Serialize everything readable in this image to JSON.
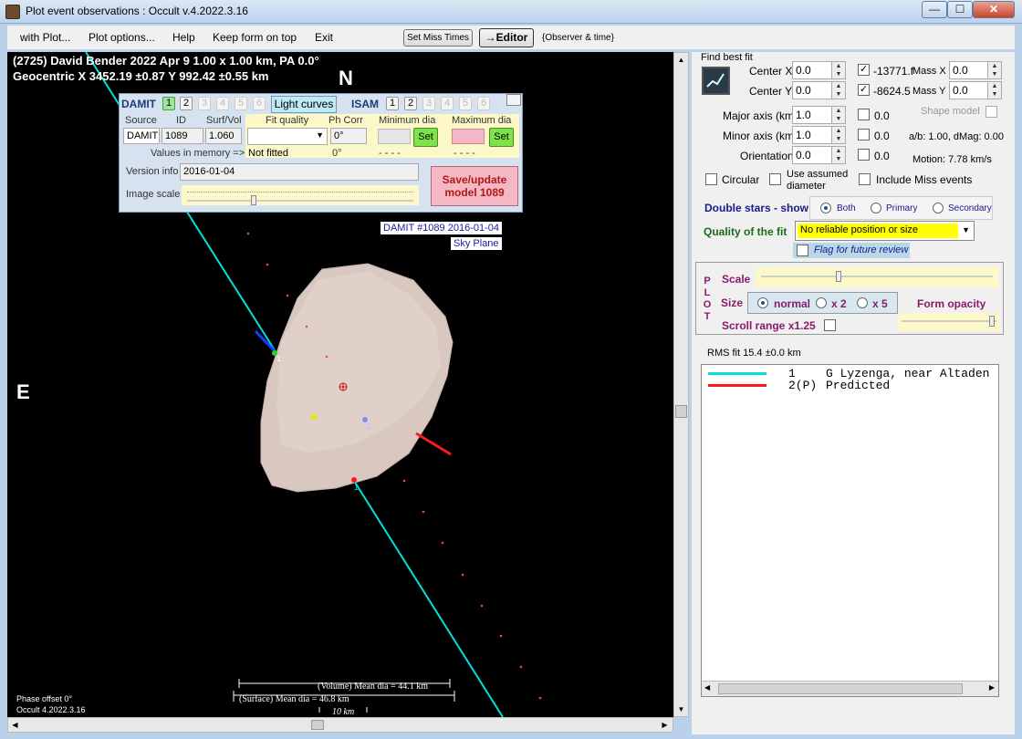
{
  "window": {
    "title": "Plot event observations : Occult v.4.2022.3.16",
    "minimize": "—",
    "maximize": "☐",
    "close": "✕"
  },
  "menu": {
    "items": [
      "with Plot...",
      "Plot options...",
      "Help",
      "Keep form on top",
      "Exit"
    ],
    "set_miss_times": "Set Miss Times",
    "editor": "→Editor",
    "observer_time": "{Observer & time}"
  },
  "plot": {
    "header_line1": "(2725) David Bender  2022 Apr 9   1.00 x 1.00 km,  PA 0.0°",
    "header_line2": "Geocentric  X  3452.19 ±0.87  Y 992.42 ±0.55 km",
    "north": "N",
    "east": "E",
    "model_label_1": "DAMIT #1089 2016-01-04",
    "model_label_2": "Sky Plane",
    "chord_1": "1",
    "chord_2": "2",
    "volume_dia": "(Volume) Mean dia = 44.1 km",
    "surface_dia": "(Surface) Mean dia = 46.8 km",
    "scale_bar": "10 km",
    "phase_offset": "Phase offset 0°",
    "version": "Occult 4.2022.3.16",
    "colors": {
      "chord_observed": "#00e0e0",
      "chord_predicted": "#ff1a1a",
      "shape": "#d9c8c0"
    }
  },
  "damit": {
    "title": "DAMIT",
    "tabs": [
      "1",
      "2",
      "3",
      "4",
      "5",
      "6"
    ],
    "light_curves": "Light curves",
    "isam": "ISAM",
    "isam_tabs": [
      "1",
      "2",
      "3",
      "4",
      "5",
      "6"
    ],
    "col_source": "Source",
    "col_id": "ID",
    "col_surf": "Surf/Vol",
    "col_fit": "Fit quality",
    "col_phcorr": "Ph Corr",
    "col_min": "Minimum dia",
    "col_max": "Maximum dia",
    "source": "DAMIT",
    "id": "1089",
    "surf_vol": "1.060",
    "fit_value": "",
    "phcorr": "0°",
    "set_min": "Set",
    "set_max": "Set",
    "values_in_memory": "Values in memory =>",
    "not_fitted": "Not fitted",
    "mem_phcorr": "0°",
    "mem_min": "- - - -",
    "mem_max": "- - - -",
    "version_info_label": "Version info",
    "version_info": "2016-01-04",
    "image_scale_label": "Image scale",
    "save_update": "Save/update",
    "save_model": "model 1089"
  },
  "fit": {
    "find_best_fit": "Find best fit",
    "center_x_label": "Center X",
    "center_x": "0.0",
    "center_y_label": "Center Y",
    "center_y": "0.0",
    "x_val": "-13771.f",
    "y_val": "-8624.5",
    "mass_x_label": "Mass X",
    "mass_x": "0.0",
    "mass_y_label": "Mass Y",
    "mass_y": "0.0",
    "major_label": "Major axis (km)",
    "major": "1.0",
    "major_chk": "0.0",
    "minor_label": "Minor axis (km)",
    "minor": "1.0",
    "minor_chk": "0.0",
    "orient_label": "Orientation",
    "orient": "0.0",
    "orient_chk": "0.0",
    "shape_model": "Shape model",
    "ab": "a/b: 1.00, dMag: 0.00",
    "motion": "Motion: 7.78 km/s",
    "circular": "Circular",
    "use_assumed": "Use assumed",
    "diameter": "diameter",
    "include_miss": "Include Miss events",
    "double_stars": "Double stars - show",
    "ds_both": "Both",
    "ds_primary": "Primary",
    "ds_secondary": "Secondary",
    "quality_label": "Quality of the fit",
    "quality_value": "No reliable position or size",
    "flag_review": "Flag for future review"
  },
  "plotopts": {
    "letters": [
      "P",
      "L",
      "O",
      "T"
    ],
    "scale": "Scale",
    "size": "Size",
    "normal": "normal",
    "x2": "x 2",
    "x5": "x 5",
    "form_opacity": "Form opacity",
    "scroll_range": "Scroll range x1.25"
  },
  "rms": "RMS fit 15.4 ±0.0 km",
  "legend": [
    {
      "num": "1",
      "name": "G Lyzenga, near Altaden"
    },
    {
      "num": "2(P)",
      "name": "Predicted"
    }
  ]
}
